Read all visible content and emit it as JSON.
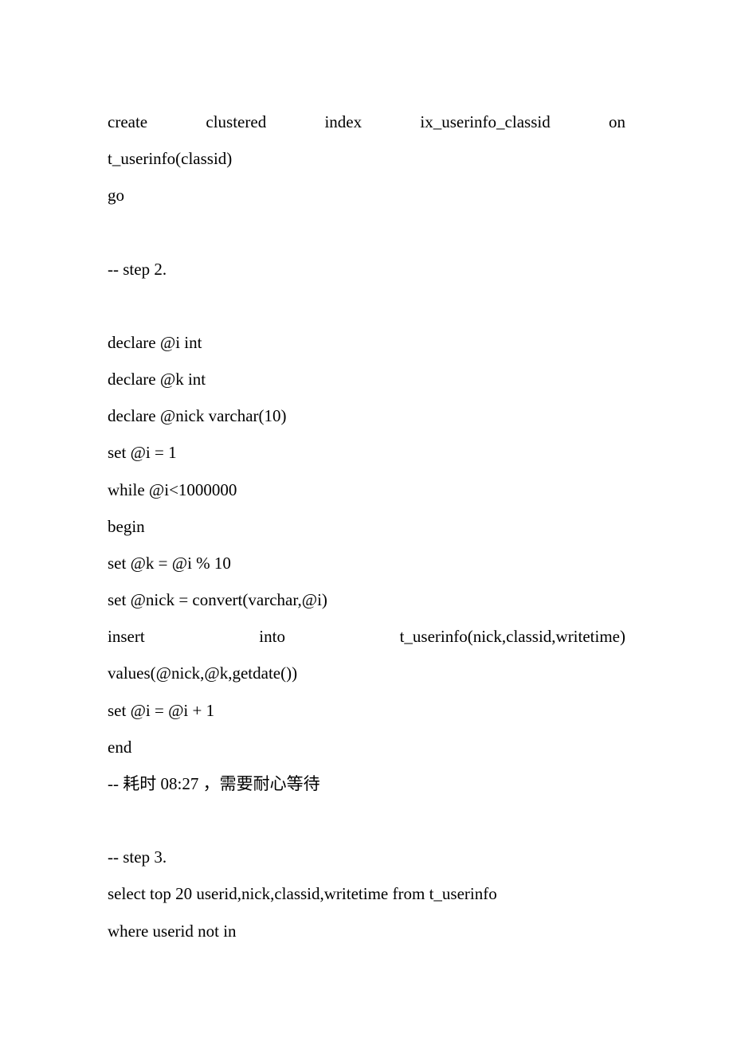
{
  "lines": [
    {
      "text": "create    clustered    index    ix_userinfo_classid    on",
      "justify": true
    },
    {
      "text": "t_userinfo(classid)"
    },
    {
      "text": "go"
    },
    {
      "spacer": true
    },
    {
      "text": "-- step 2."
    },
    {
      "spacer": true
    },
    {
      "text": "declare @i int"
    },
    {
      "text": "declare @k int"
    },
    {
      "text": "declare @nick varchar(10)"
    },
    {
      "text": "set @i = 1"
    },
    {
      "text": "while @i<1000000"
    },
    {
      "text": "begin"
    },
    {
      "text": "set @k = @i % 10"
    },
    {
      "text": "set @nick = convert(varchar,@i)"
    },
    {
      "text": "insert         into         t_userinfo(nick,classid,writetime)",
      "justify": true
    },
    {
      "text": "values(@nick,@k,getdate())"
    },
    {
      "text": "set @i = @i + 1"
    },
    {
      "text": "end"
    },
    {
      "text": "-- 耗时 08:27 ，需要耐心等待"
    },
    {
      "spacer": true
    },
    {
      "text": "-- step 3."
    },
    {
      "text": "select top 20 userid,nick,classid,writetime from t_userinfo"
    },
    {
      "text": "where userid not in"
    }
  ]
}
